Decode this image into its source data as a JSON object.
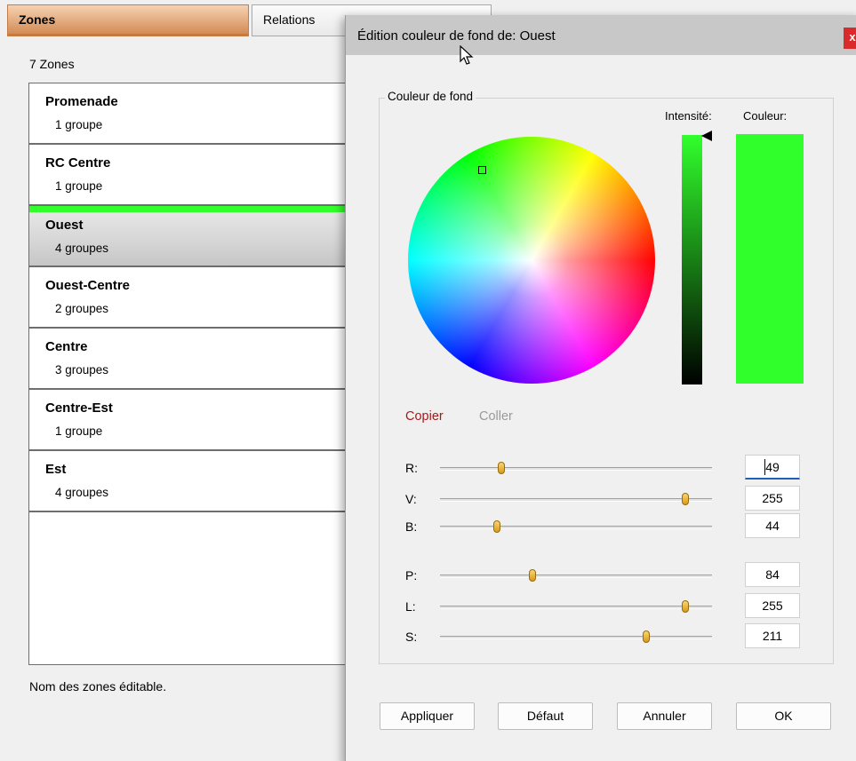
{
  "tabs": {
    "zones": "Zones",
    "relations": "Relations"
  },
  "zone_count": "7 Zones",
  "zones": [
    {
      "name": "Promenade",
      "groups": "1 groupe"
    },
    {
      "name": "RC Centre",
      "groups": "1 groupe"
    },
    {
      "name": "Ouest",
      "groups": "4 groupes",
      "selected": true
    },
    {
      "name": "Ouest-Centre",
      "groups": "2 groupes"
    },
    {
      "name": "Centre",
      "groups": "3 groupes"
    },
    {
      "name": "Centre-Est",
      "groups": "1 groupe"
    },
    {
      "name": "Est",
      "groups": "4 groupes"
    }
  ],
  "footnote": "Nom des zones éditable.",
  "dialog": {
    "title": "Édition couleur de fond de: Ouest",
    "close": "x",
    "group_label": "Couleur de fond",
    "intensity_label": "Intensité:",
    "color_label": "Couleur:",
    "copy": "Copier",
    "paste": "Coller",
    "current_color": "#31ff2c",
    "sliders": [
      {
        "label": "R:",
        "value": "49",
        "max": 255
      },
      {
        "label": "V:",
        "value": "255",
        "max": 255
      },
      {
        "label": "B:",
        "value": "44",
        "max": 255
      },
      {
        "label": "P:",
        "value": "84",
        "max": 255
      },
      {
        "label": "L:",
        "value": "255",
        "max": 255
      },
      {
        "label": "S:",
        "value": "211",
        "max": 255
      }
    ],
    "buttons": {
      "apply": "Appliquer",
      "default": "Défaut",
      "cancel": "Annuler",
      "ok": "OK"
    }
  }
}
